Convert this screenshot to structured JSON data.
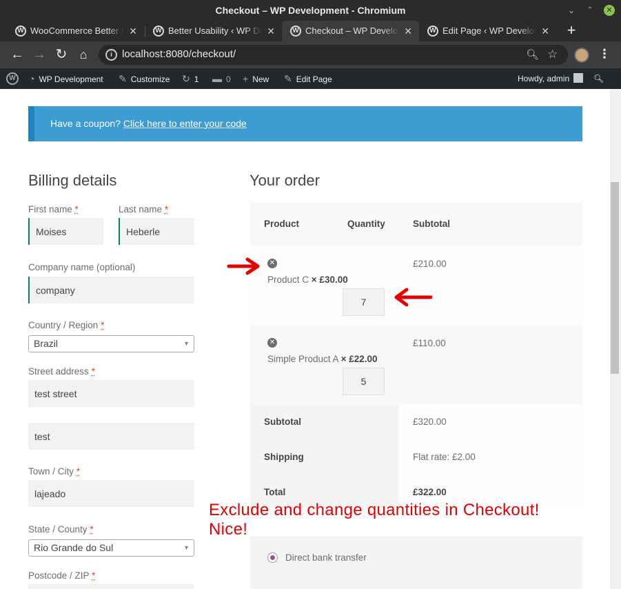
{
  "window": {
    "title": "Checkout – WP Development - Chromium"
  },
  "tabs": [
    {
      "label": "WooCommerce Better Usability",
      "active": false
    },
    {
      "label": "Better Usability ‹ WP Development",
      "active": false
    },
    {
      "label": "Checkout – WP Development",
      "active": true
    },
    {
      "label": "Edit Page ‹ WP Development",
      "active": false
    }
  ],
  "toolbar": {
    "url": "localhost:8080/checkout/"
  },
  "adminbar": {
    "site": "WP Development",
    "customize": "Customize",
    "updates": "1",
    "comments": "0",
    "new": "New",
    "edit_page": "Edit Page",
    "howdy": "Howdy, admin"
  },
  "coupon": {
    "text": "Have a coupon?",
    "link": "Click here to enter your code"
  },
  "billing": {
    "title": "Billing details",
    "first_name_label": "First name",
    "first_name": "Moises",
    "last_name_label": "Last name",
    "last_name": "Heberle",
    "company_label": "Company name (optional)",
    "company": "company",
    "country_label": "Country / Region",
    "country": "Brazil",
    "street_label": "Street address",
    "street": "test street",
    "street2": "test",
    "town_label": "Town / City",
    "town": "lajeado",
    "state_label": "State / County",
    "state": "Rio Grande do Sul",
    "postcode_label": "Postcode / ZIP",
    "required_mark": "*"
  },
  "order": {
    "title": "Your order",
    "col_product": "Product",
    "col_quantity": "Quantity",
    "col_subtotal": "Subtotal",
    "items": [
      {
        "name": "Product C",
        "price": "× £30.00",
        "qty": "7",
        "subtotal": "£210.00"
      },
      {
        "name": "Simple Product A",
        "price": "× £22.00",
        "qty": "5",
        "subtotal": "£110.00"
      }
    ],
    "subtotal_label": "Subtotal",
    "subtotal": "£320.00",
    "shipping_label": "Shipping",
    "shipping": "Flat rate: £2.00",
    "total_label": "Total",
    "total": "£322.00"
  },
  "payment": {
    "method": "Direct bank transfer"
  },
  "annotation": {
    "line1": "Exclude and change quantities in Checkout!",
    "line2": "Nice!",
    "color": "#e20000"
  }
}
